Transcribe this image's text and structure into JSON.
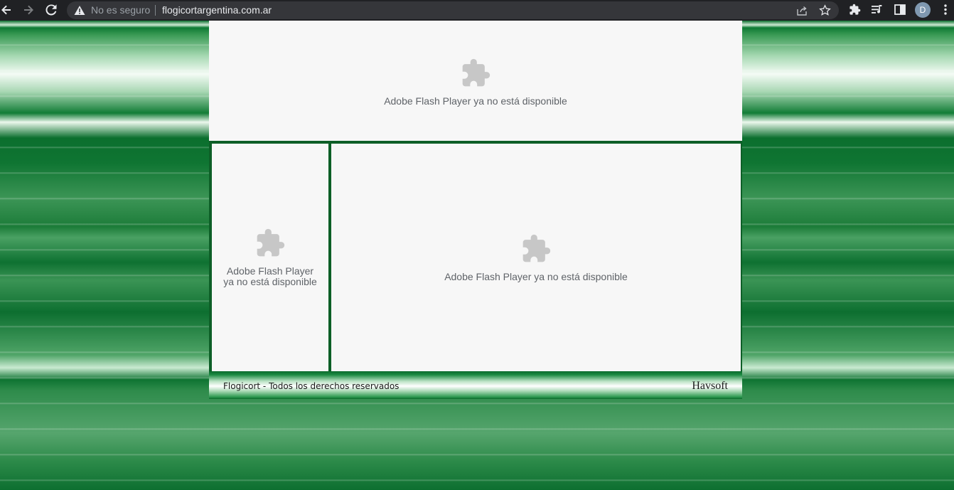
{
  "browser": {
    "back_icon": "arrow-left-icon",
    "forward_icon": "arrow-right-icon",
    "reload_icon": "reload-icon",
    "security_label": "No es seguro",
    "url": "flogicortargentina.com.ar",
    "profile_initial": "D",
    "colors": {
      "toolbar": "#202124",
      "omnibox": "#35363a",
      "avatar": "#7f98b0"
    }
  },
  "page": {
    "banner": {
      "message": "Adobe Flash Player ya no está disponible",
      "icon": "puzzle-piece-icon"
    },
    "left_panel": {
      "message": "Adobe Flash Player ya no está disponible",
      "icon": "puzzle-piece-icon"
    },
    "main_panel": {
      "message": "Adobe Flash Player ya no está disponible",
      "icon": "puzzle-piece-icon"
    },
    "footer": {
      "copyright": "Flogicort - Todos los derechos reservados",
      "credit": "Havsoft"
    },
    "colors": {
      "frame": "#0d5f27",
      "placeholder_bg": "#f7f7f7",
      "placeholder_text": "#5f6368",
      "icon": "#c7c7c7"
    }
  }
}
